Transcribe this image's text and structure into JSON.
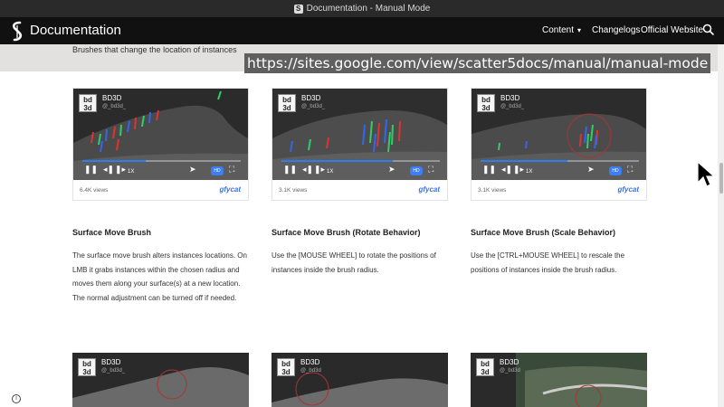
{
  "window": {
    "title": "Documentation - Manual Mode"
  },
  "nav": {
    "site_title": "Documentation",
    "content": "Content",
    "changelogs": "Changelogs",
    "official": "Official Website"
  },
  "banner": {
    "text": "Brushes that change the location of instances",
    "url": "https://sites.google.com/view/scatter5docs/manual/manual-mode"
  },
  "videos": [
    {
      "channel": "BD3D",
      "handle": "@_bd3d_",
      "speed": "1X",
      "hd": "HD",
      "views": "6.4K views",
      "brand": "gfycat",
      "progress": 0.4
    },
    {
      "channel": "BD3D",
      "handle": "@_bd3d_",
      "speed": "1X",
      "hd": "HD",
      "views": "3.1K views",
      "brand": "gfycat",
      "progress": 0.7
    },
    {
      "channel": "BD3D",
      "handle": "@_bd3d_",
      "speed": "1X",
      "hd": "HD",
      "views": "3.1K views",
      "brand": "gfycat",
      "progress": 0.55
    }
  ],
  "sections": [
    {
      "title": "Surface Move Brush",
      "desc": "The surface move brush alters instances locations. On LMB it grabs instances within the chosen radius and moves them along your surface(s) at a new location. The normal adjustment can be turned off if needed."
    },
    {
      "title": "Surface Move Brush (Rotate Behavior)",
      "desc": "Use the [MOUSE WHEEL] to rotate the positions of instances inside the brush radius."
    },
    {
      "title": "Surface Move Brush (Scale Behavior)",
      "desc": "Use the [CTRL+MOUSE WHEEL] to rescale the positions of instances inside the brush radius."
    }
  ],
  "bottom_videos": [
    {
      "channel": "BD3D",
      "handle": "@_bd3d_"
    },
    {
      "channel": "BD3D",
      "handle": "@_bd3d"
    },
    {
      "channel": "BD3D",
      "handle": "@_bd3d"
    }
  ],
  "logo_text": "bd\n3d",
  "colors": {
    "accent": "#2d7ff0",
    "nav_bg": "#111111",
    "banner_bg": "#e3e1df"
  }
}
